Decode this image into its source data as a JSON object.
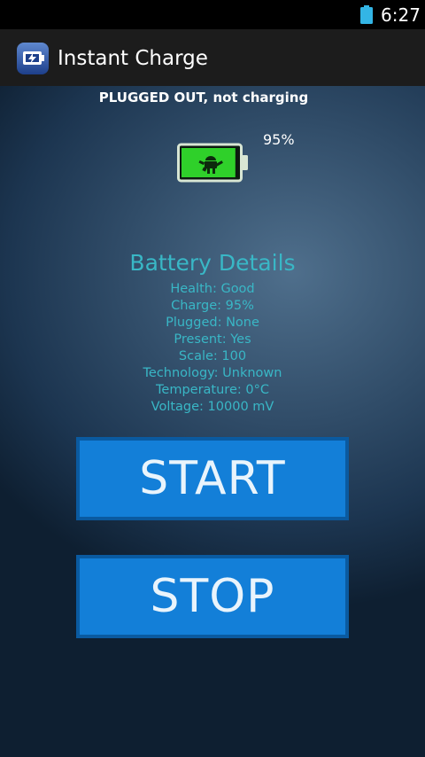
{
  "status_bar": {
    "time": "6:27",
    "battery_icon": "battery-full-icon"
  },
  "action_bar": {
    "app_icon": "app-logo-icon",
    "title": "Instant Charge"
  },
  "charge_status": "PLUGGED OUT, not charging",
  "battery": {
    "icon": "battery-android-icon",
    "percent_label": "95%",
    "level": 0.95,
    "fill_color": "#2fd02a"
  },
  "details": {
    "title": "Battery Details",
    "items": [
      "Health: Good",
      "Charge: 95%",
      "Plugged: None",
      "Present: Yes",
      "Scale: 100",
      "Technology: Unknown",
      "Temperature: 0°C",
      "Voltage: 10000 mV"
    ],
    "color": "#39b7c6"
  },
  "buttons": {
    "start_label": "START",
    "stop_label": "STOP",
    "color": "#137fd8"
  }
}
